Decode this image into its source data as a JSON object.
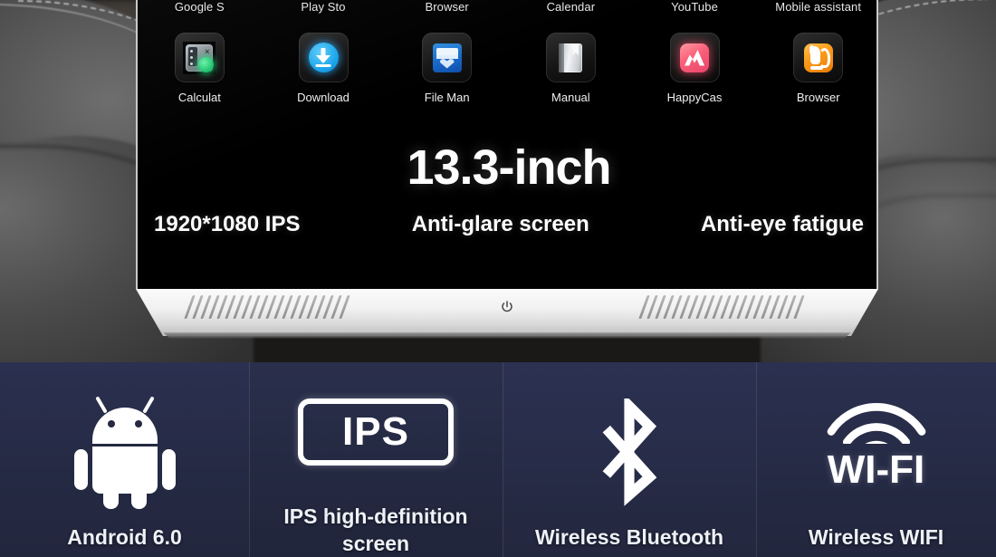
{
  "screen": {
    "top_labels": [
      "Google S",
      "Play Sto",
      "Browser",
      "Calendar",
      "YouTube",
      "Mobile assistant"
    ],
    "apps": [
      {
        "label": "Calculat",
        "icon": "calculator-icon"
      },
      {
        "label": "Download",
        "icon": "download-icon"
      },
      {
        "label": "File Man",
        "icon": "file-manager-icon"
      },
      {
        "label": "Manual",
        "icon": "manual-book-icon"
      },
      {
        "label": "HappyCas",
        "icon": "happycast-icon"
      },
      {
        "label": "Browser",
        "icon": "uc-browser-icon"
      }
    ],
    "headline": "13.3-inch",
    "features": [
      "1920*1080 IPS",
      "Anti-glare screen",
      "Anti-eye fatigue"
    ],
    "power_icon": "power-icon"
  },
  "feature_strip": [
    {
      "icon": "android-robot-icon",
      "caption": "Android 6.0"
    },
    {
      "icon": "ips-badge-icon",
      "badge_text": "IPS",
      "caption": "IPS high-definition\nscreen"
    },
    {
      "icon": "bluetooth-icon",
      "caption": "Wireless Bluetooth"
    },
    {
      "icon": "wifi-icon",
      "badge_text": "WI-FI",
      "caption": "Wireless WIFI"
    }
  ],
  "colors": {
    "strip_background": "#262b46",
    "screen_background": "#000000",
    "bezel": "#f1f1f1",
    "text_white": "#ffffff",
    "download_blue": "#1aa6ec",
    "calculator_green": "#17c06a",
    "file_manager_blue": "#1765c8",
    "happycast_pink": "#fa5f79",
    "browser_orange": "#fb9a18"
  }
}
